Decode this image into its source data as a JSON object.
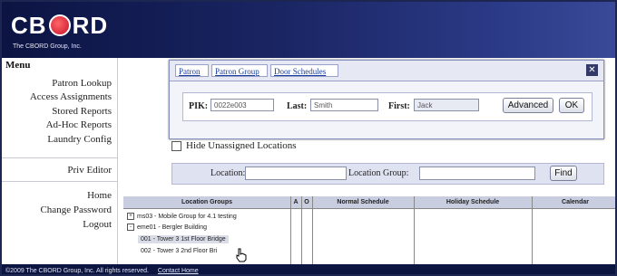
{
  "app": {
    "logo_text_left": "CB",
    "logo_text_right": "RD",
    "logo_sub": "The CBORD Group, Inc."
  },
  "sidebar": {
    "title": "Menu",
    "items": [
      {
        "label": "Patron Lookup"
      },
      {
        "label": "Access Assignments"
      },
      {
        "label": "Stored Reports"
      },
      {
        "label": "Ad-Hoc Reports"
      },
      {
        "label": "Laundry Config"
      }
    ],
    "editor": {
      "label": "Priv Editor"
    },
    "bottom": [
      {
        "label": "Home"
      },
      {
        "label": "Change Password"
      },
      {
        "label": "Logout"
      }
    ]
  },
  "popup": {
    "tabs": [
      "Patron",
      "Patron Group",
      "Door Schedules"
    ],
    "close_icon": "close-icon",
    "pik_label": "PIK:",
    "pik_value": "0022e003",
    "last_label": "Last:",
    "last_value": "Smith",
    "first_label": "First:",
    "first_value": "Jack",
    "advanced_label": "Advanced",
    "ok_label": "OK"
  },
  "options": {
    "hide_unassigned_label": "Hide Unassigned Locations"
  },
  "search": {
    "location_label": "Location:",
    "location_value": "",
    "group_label": "Location Group:",
    "group_value": "",
    "find_label": "Find"
  },
  "grid": {
    "headers": [
      "Location Groups",
      "A",
      "O",
      "Normal Schedule",
      "Holiday Schedule",
      "Calendar"
    ],
    "rows": [
      {
        "toggle": "+",
        "text": "ms03 - Mobile Group for 4.1 testing"
      },
      {
        "toggle": "-",
        "text": "eme01 - Bergler Building"
      },
      {
        "toggle": "",
        "text": "001 - Tower 3 1st Floor Bridge"
      },
      {
        "toggle": "",
        "text": "002 - Tower 3 2nd Floor Bri"
      }
    ]
  },
  "footer": {
    "copyright": "©2009 The CBORD Group, Inc. All rights reserved.",
    "link": "Contact Home"
  },
  "colors": {
    "header_dark": "#0b1442",
    "header_light": "#3a4a99",
    "link_blue": "#1a3c9a",
    "logo_red": "#c8102e"
  }
}
